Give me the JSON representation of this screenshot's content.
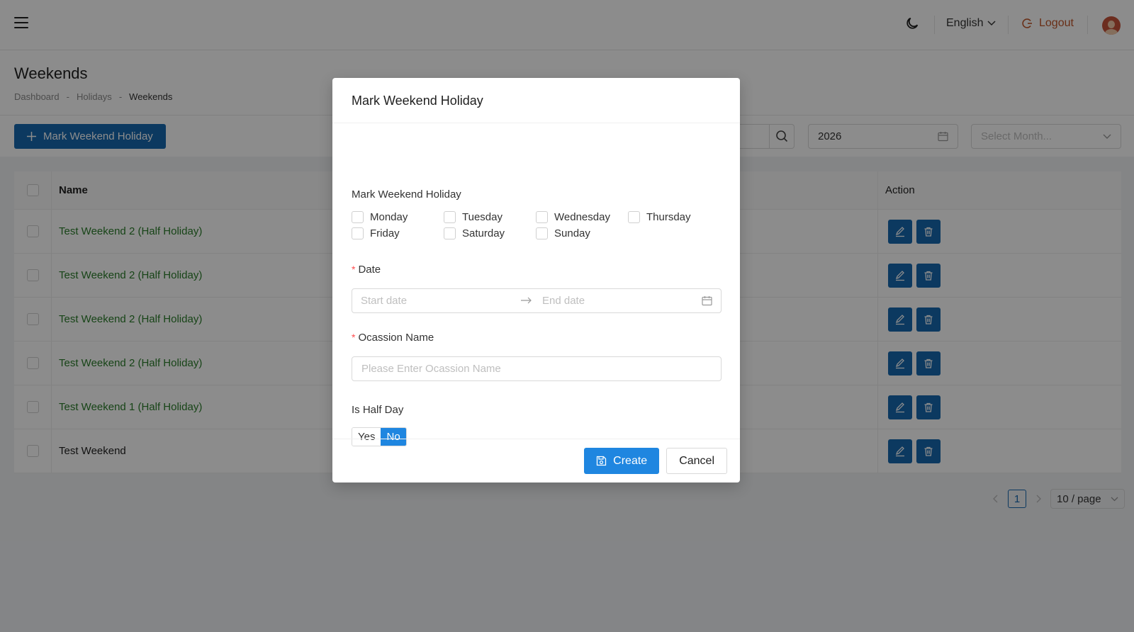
{
  "topbar": {
    "language": "English",
    "logout_label": "Logout"
  },
  "page": {
    "title": "Weekends",
    "breadcrumb": [
      "Dashboard",
      "-",
      "Holidays",
      "-",
      "Weekends"
    ]
  },
  "toolbar": {
    "add_label": "Mark Weekend Holiday",
    "year_value": "2026",
    "month_placeholder": "Select Month..."
  },
  "table": {
    "headers": {
      "name": "Name",
      "action": "Action"
    },
    "rows": [
      {
        "name": "Test Weekend 2 (Half Holiday)"
      },
      {
        "name": "Test Weekend 2 (Half Holiday)"
      },
      {
        "name": "Test Weekend 2 (Half Holiday)"
      },
      {
        "name": "Test Weekend 2 (Half Holiday)"
      },
      {
        "name": "Test Weekend 1 (Half Holiday)"
      },
      {
        "name": "Test Weekend"
      }
    ]
  },
  "pagination": {
    "current_page": "1",
    "page_size": "10 / page"
  },
  "modal": {
    "title": "Mark Weekend Holiday",
    "days_label": "Mark Weekend Holiday",
    "days": [
      "Monday",
      "Tuesday",
      "Wednesday",
      "Thursday",
      "Friday",
      "Saturday",
      "Sunday"
    ],
    "date_label": "Date",
    "start_placeholder": "Start date",
    "end_placeholder": "End date",
    "occasion_label": "Ocassion Name",
    "occasion_placeholder": "Please Enter Ocassion Name",
    "half_day_label": "Is Half Day",
    "half_day_yes": "Yes",
    "half_day_no": "No",
    "create_label": "Create",
    "cancel_label": "Cancel"
  },
  "colors": {
    "primary": "#1668b0",
    "accent": "#1f86e0",
    "half_holiday_text": "#2a7d2a",
    "logout": "#c0562a"
  }
}
